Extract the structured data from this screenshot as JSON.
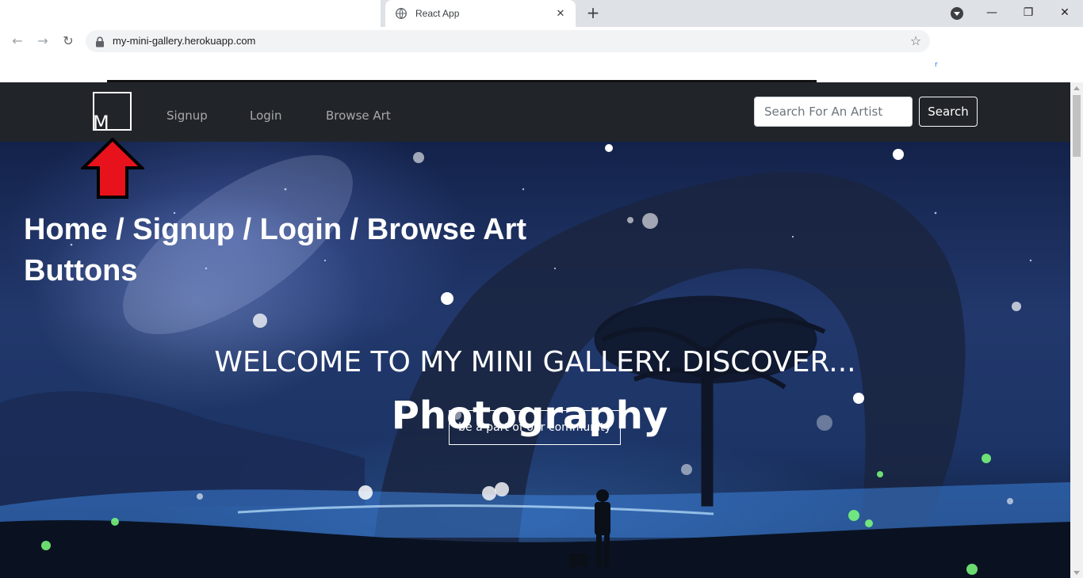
{
  "browser": {
    "tab_title": "React App",
    "url": "my-mini-gallery.herokuapp.com",
    "new_tab_glyph": "+",
    "close_tab_glyph": "✕",
    "back_glyph": "←",
    "forward_glyph": "→",
    "reload_glyph": "↻",
    "star_glyph": "☆",
    "minimize_glyph": "—",
    "restore_glyph": "❐",
    "close_window_glyph": "✕",
    "bookmark_mark": "r"
  },
  "site": {
    "logo_text": "M",
    "nav": {
      "signup": "Signup",
      "login": "Login",
      "browse": "Browse Art"
    },
    "search": {
      "placeholder": "Search For An Artist",
      "button": "Search"
    }
  },
  "annotation": {
    "line1": "Home / Signup / Login / Browse Art",
    "line2": "Buttons"
  },
  "hero": {
    "welcome": "WELCOME TO MY MINI GALLERY. DISCOVER...",
    "rotating_word": "Photography",
    "cta": "be a part of our community"
  },
  "colors": {
    "navbar": "#212529",
    "arrow_fill": "#e8121c",
    "arrow_stroke": "#000000"
  },
  "icons": [
    "globe-icon",
    "lock-icon",
    "star-icon",
    "profile-menu-icon",
    "up-arrow-annotation-icon"
  ]
}
